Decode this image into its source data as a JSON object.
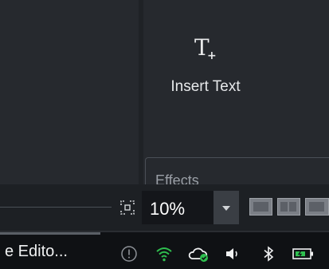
{
  "canvas": {
    "insert_text_label": "Insert Text",
    "insert_text_glyph": "T",
    "insert_text_plus": "+",
    "effects_label": "Effects"
  },
  "toolbar": {
    "fit_icon": "fit-to-window-icon",
    "zoom_value": "10%",
    "view_buttons": [
      "view-thumbnail-icon",
      "view-filmstrip-icon",
      "view-grid-icon"
    ]
  },
  "taskbar": {
    "app_title": "e Edito...",
    "tray_icons": [
      "alert-icon",
      "wifi-icon",
      "onedrive-sync-icon",
      "volume-icon",
      "bluetooth-icon",
      "battery-icon"
    ],
    "colors": {
      "wifi": "#2fbf4f",
      "sync_check": "#2fbf4f",
      "battery_fill": "#2fbf4f"
    }
  }
}
